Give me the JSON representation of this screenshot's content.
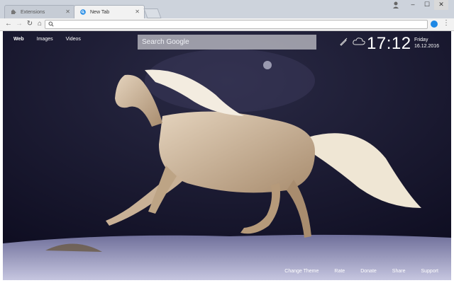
{
  "browser": {
    "tabs": [
      {
        "label": "Extensions",
        "icon": "puzzle-icon",
        "active": false
      },
      {
        "label": "New Tab",
        "icon": "newtab-icon",
        "active": true
      }
    ],
    "omnibox_value": ""
  },
  "page": {
    "nav": [
      "Web",
      "Images",
      "Videos"
    ],
    "search_placeholder": "Search Google",
    "clock": "17:12",
    "day": "Friday",
    "date": "16.12.2016",
    "weather_icons": [
      "brush-icon",
      "cloud-icon"
    ],
    "footer_links": [
      "Change Theme",
      "Rate",
      "Donate",
      "Share",
      "Support"
    ]
  },
  "colors": {
    "accent": "#1e88e5",
    "sky": "#15132a",
    "snow": "#b7b7d6"
  }
}
